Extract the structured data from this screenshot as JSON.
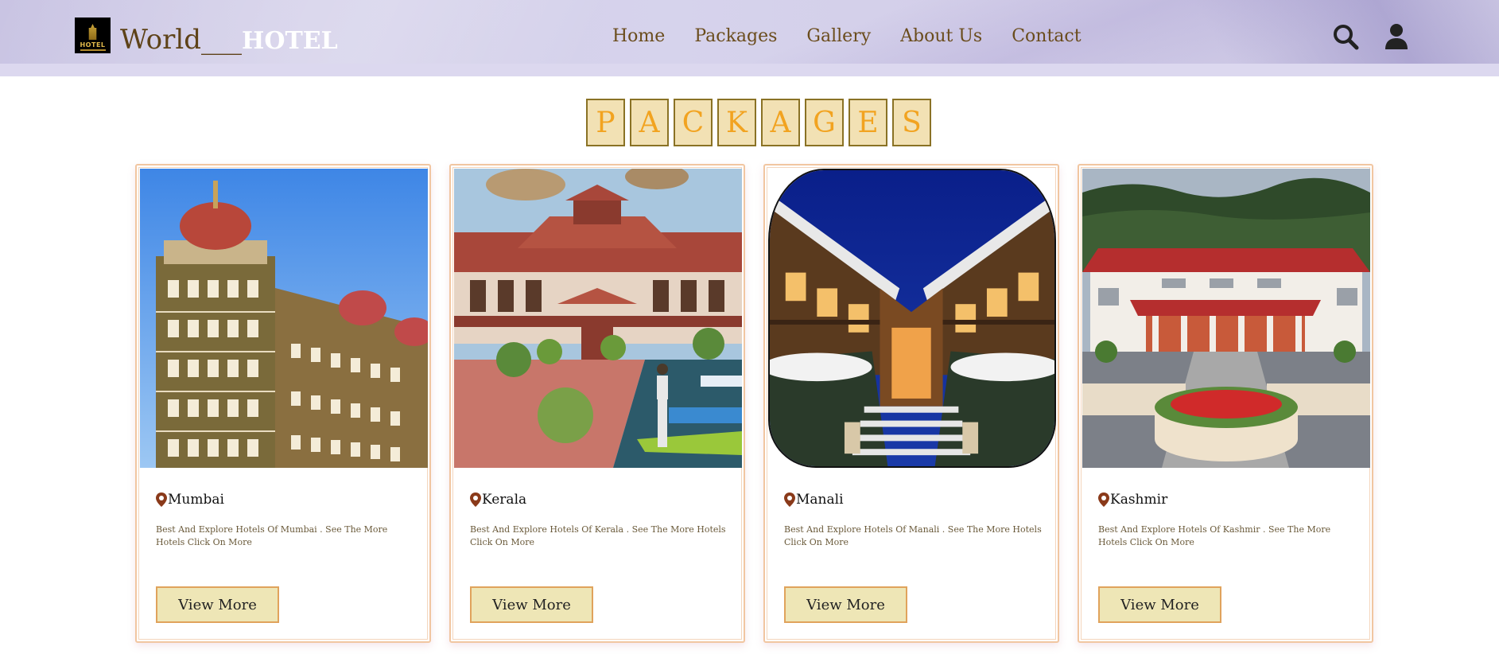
{
  "header": {
    "logo_text": "HOTEL",
    "brand_part1": "World___",
    "brand_part2": "HOTEL",
    "nav": [
      "Home",
      "Packages",
      "Gallery",
      "About Us",
      "Contact"
    ],
    "icons": [
      "search-icon",
      "user-icon"
    ]
  },
  "title_letters": [
    "P",
    "A",
    "C",
    "K",
    "A",
    "G",
    "E",
    "S"
  ],
  "cards": [
    {
      "location": "Mumbai",
      "description": "Best And Explore Hotels Of Mumbai . See The More Hotels Click On More",
      "button": "View More"
    },
    {
      "location": "Kerala",
      "description": "Best And Explore Hotels Of Kerala . See The More Hotels Click On More",
      "button": "View More"
    },
    {
      "location": "Manali",
      "description": "Best And Explore Hotels Of Manali . See The More Hotels Click On More",
      "button": "View More"
    },
    {
      "location": "Kashmir",
      "description": "Best And Explore Hotels Of Kashmir . See The More Hotels Click On More",
      "button": "View More"
    }
  ],
  "colors": {
    "header_bg": "#d3cfe9",
    "nav_text": "#6a4c1c",
    "title_letter": "#f2a320",
    "title_box_bg": "#f2e1b4",
    "button_bg": "#eee6b6",
    "button_border": "#e0a35c",
    "card_border": "#f1c6a1"
  }
}
